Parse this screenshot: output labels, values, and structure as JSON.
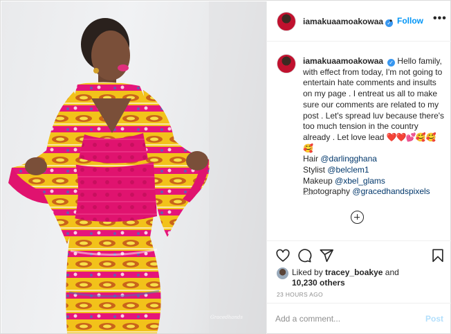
{
  "post": {
    "username": "iamakuaamoakowaa",
    "verified_mark": "✓",
    "dot": "•",
    "follow_label": "Follow",
    "more_label": "•••",
    "photo_watermark": "Gracedhands"
  },
  "caption": {
    "username": "iamakuaamoakowaa",
    "body": "Hello family, with effect from today, I'm not going to entertain hate comments and insults on my page . I entreat us all to make sure our comments are related to my post . Let's spread luv because there's too much tension in the country already . Let love lead",
    "emojis_hearts": "❤️❤️💕",
    "emojis_faces": "🥰🥰🥰",
    "hair_label": "Hair",
    "hair_mention": "@darlingghana",
    "stylist_label": "Stylist",
    "stylist_mention": "@belclem1",
    "makeup_label": "Makeup",
    "makeup_mention": "@xbel_glams",
    "photography_label": "Photography",
    "photography_mention": "@gracedhandspixels",
    "time": "23h"
  },
  "actions": {
    "icons": [
      "heart-icon",
      "comment-icon",
      "share-icon",
      "bookmark-icon"
    ],
    "liked_by_prefix": "Liked by",
    "liked_by_user": "tracey_boakye",
    "and": "and",
    "others": "10,230 others",
    "timestamp": "23 HOURS AGO"
  },
  "comment": {
    "placeholder": "Add a comment...",
    "post_label": "Post"
  },
  "colors": {
    "link": "#0095f6",
    "mention": "#00376b",
    "muted": "#8e8e8e",
    "border": "#efefef"
  }
}
